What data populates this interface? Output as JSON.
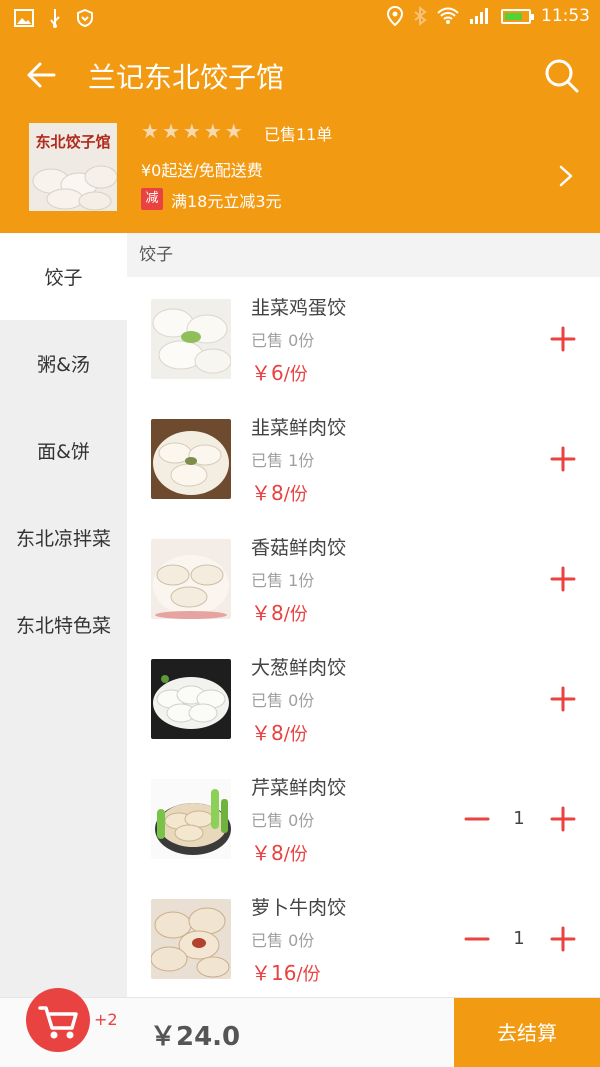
{
  "status_bar": {
    "time": "11:53"
  },
  "header": {
    "title": "兰记东北饺子馆",
    "logo_text": "东北饺子馆",
    "sold": "已售11单",
    "delivery": "¥0起送/免配送费",
    "promo_badge": "减",
    "promo": "满18元立减3元",
    "rating_stars": 5
  },
  "sidebar": {
    "categories": [
      "饺子",
      "粥&汤",
      "面&饼",
      "东北凉拌菜",
      "东北特色菜"
    ],
    "active_index": 0
  },
  "section": {
    "title": "饺子"
  },
  "foods": [
    {
      "name": "韭菜鸡蛋饺",
      "sold": "已售 0份",
      "price_symbol": "￥",
      "price": "6",
      "unit": "/份",
      "qty": ""
    },
    {
      "name": "韭菜鲜肉饺",
      "sold": "已售 1份",
      "price_symbol": "￥",
      "price": "8",
      "unit": "/份",
      "qty": ""
    },
    {
      "name": "香菇鲜肉饺",
      "sold": "已售 1份",
      "price_symbol": "￥",
      "price": "8",
      "unit": "/份",
      "qty": ""
    },
    {
      "name": "大葱鲜肉饺",
      "sold": "已售 0份",
      "price_symbol": "￥",
      "price": "8",
      "unit": "/份",
      "qty": ""
    },
    {
      "name": "芹菜鲜肉饺",
      "sold": "已售 0份",
      "price_symbol": "￥",
      "price": "8",
      "unit": "/份",
      "qty": "1"
    },
    {
      "name": "萝卜牛肉饺",
      "sold": "已售 0份",
      "price_symbol": "￥",
      "price": "16",
      "unit": "/份",
      "qty": "1"
    }
  ],
  "cart": {
    "count": "+2",
    "total": "￥24.0",
    "checkout": "去结算"
  },
  "colors": {
    "brand": "#f29a12",
    "accent": "#e84241"
  }
}
